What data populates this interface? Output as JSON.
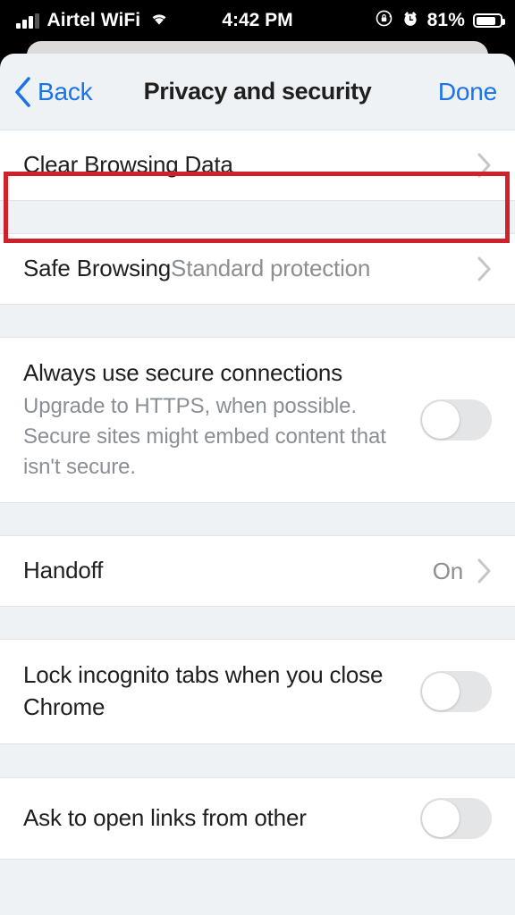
{
  "status_bar": {
    "carrier": "Airtel WiFi",
    "wifi_icon": "wifi-icon",
    "signal_icon": "cellular-signal-icon",
    "time": "4:42 PM",
    "rotation_lock_icon": "rotation-lock-icon",
    "alarm_icon": "alarm-clock-icon",
    "battery_percent": "81%",
    "battery_icon": "battery-icon"
  },
  "nav": {
    "back_label": "Back",
    "back_icon": "chevron-left-icon",
    "title": "Privacy and security",
    "done_label": "Done",
    "accent_color": "#1a73e8"
  },
  "highlight": {
    "color": "#d0212b",
    "target": "Clear Browsing Data"
  },
  "settings": [
    {
      "id": "clear-browsing-data",
      "title": "Clear Browsing Data",
      "control": "chevron",
      "highlighted": true
    },
    {
      "id": "safe-browsing",
      "title": "Safe Browsing",
      "detail": "Standard protection",
      "control": "chevron"
    },
    {
      "id": "always-use-secure-connections",
      "title": "Always use secure connections",
      "subtitle": "Upgrade to HTTPS, when possible. Secure sites might embed content that isn't secure.",
      "control": "toggle",
      "toggle_on": false
    },
    {
      "id": "handoff",
      "title": "Handoff",
      "value": "On",
      "control": "chevron"
    },
    {
      "id": "lock-incognito-tabs",
      "title": "Lock incognito tabs when you close Chrome",
      "control": "toggle",
      "toggle_on": false
    },
    {
      "id": "ask-to-open-links",
      "title": "Ask to open links from other",
      "control": "toggle",
      "toggle_on": false,
      "clipped": true
    }
  ]
}
